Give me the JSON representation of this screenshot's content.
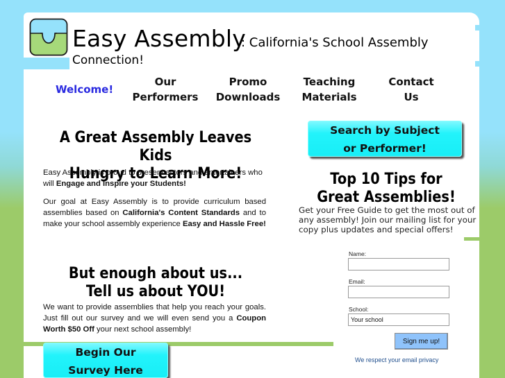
{
  "header": {
    "site_title": "Easy Assembly",
    "subtitle_part1": ": California's School Assembly",
    "subtitle_part2": "Connection!",
    "logo_icon": "puzzle-piece-icon"
  },
  "nav": {
    "items": [
      {
        "label": "Welcome!",
        "active": true
      },
      {
        "label": "Our\nPerformers"
      },
      {
        "label": "Promo\nDownloads"
      },
      {
        "label": "Teaching\nMaterials"
      },
      {
        "label": "Contact\nUs"
      }
    ]
  },
  "main": {
    "headline1": "A Great Assembly Leaves Kids\nHungry to Learn More!",
    "para1": {
      "text": "Easy Assembly is proud to present actors and entertainers who will ",
      "bold": "Engage and Inspire your Students!"
    },
    "para2": {
      "text1": "Our goal at Easy Assembly is to provide curriculum based assemblies based on ",
      "bold1": "California's Content Standards",
      "text2": " and to make your school assembly experience ",
      "bold2": "Easy and Hassle Free!"
    },
    "headline2": "But enough about us...\nTell us about YOU!",
    "para3": {
      "text1": "We want to provide assemblies that help you reach your goals. Just fill out our survey and we will even send you a ",
      "bold1": "Coupon Worth $50 Off",
      "text2": " your next school assembly!"
    },
    "survey_button": "Begin Our\nSurvey Here"
  },
  "sidebar": {
    "search_button": "Search by Subject\nor Performer!",
    "tips_heading": "Top 10 Tips for\nGreat Assemblies!",
    "tips_text": "Get your Free Guide to get the most out of any assembly! Join our mailing list for your copy plus updates and special offers!",
    "form": {
      "name_label": "Name:",
      "name_value": "",
      "email_label": "Email:",
      "email_value": "",
      "school_label": "School:",
      "school_value": "Your school",
      "submit_label": "Sign me up!",
      "privacy_link": "We respect your email privacy"
    }
  },
  "colors": {
    "sky_blue": "#95e2fb",
    "grass_green": "#9ccb69",
    "button_cyan": "#22f3fb",
    "nav_active": "#2a2ae0",
    "signup_blue": "#8fc3fb",
    "link_blue": "#1e4d8c"
  }
}
